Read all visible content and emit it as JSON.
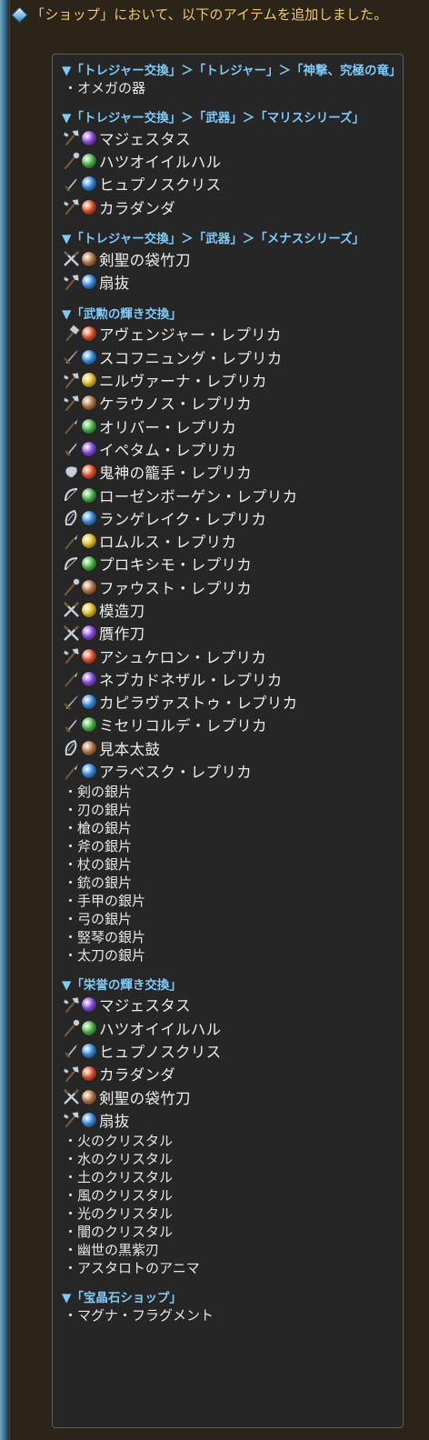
{
  "notice": "「ショップ」において、以下のアイテムを追加しました。",
  "colors": {
    "notice_text": "#f3c86a",
    "category": "#7ec9f5",
    "fire": "#e0552f",
    "water": "#3b8fe0",
    "earth": "#b7784a",
    "wind": "#4db84a",
    "light": "#e6c22a",
    "dark": "#8a4fe0"
  },
  "sections": [
    {
      "title": "▼「トレジャー交換」＞「トレジャー」＞「神撃、究極の竜」",
      "items": [],
      "bullets": [
        "・オメガの器"
      ]
    },
    {
      "title": "▼「トレジャー交換」＞「武器」＞「マリスシリーズ」",
      "items": [
        {
          "name": "マジェスタス",
          "weapon": "axe",
          "element": "dark"
        },
        {
          "name": "ハツオイイルハル",
          "weapon": "staff",
          "element": "wind"
        },
        {
          "name": "ヒュプノスクリス",
          "weapon": "dagger",
          "element": "water"
        },
        {
          "name": "カラダンダ",
          "weapon": "axe",
          "element": "fire"
        }
      ],
      "bullets": []
    },
    {
      "title": "▼「トレジャー交換」＞「武器」＞「メナスシリーズ」",
      "items": [
        {
          "name": "剣聖の袋竹刀",
          "weapon": "katana",
          "element": "earth"
        },
        {
          "name": "扇抜",
          "weapon": "axe",
          "element": "water"
        }
      ],
      "bullets": []
    },
    {
      "title": "▼「武勲の輝き交換」",
      "items": [
        {
          "name": "アヴェンジャー・レプリカ",
          "weapon": "hammer",
          "element": "fire"
        },
        {
          "name": "スコフニュング・レプリカ",
          "weapon": "sword",
          "element": "water"
        },
        {
          "name": "ニルヴァーナ・レプリカ",
          "weapon": "axe",
          "element": "light"
        },
        {
          "name": "ケラウノス・レプリカ",
          "weapon": "axe",
          "element": "earth"
        },
        {
          "name": "オリバー・レプリカ",
          "weapon": "spear",
          "element": "wind"
        },
        {
          "name": "イペタム・レプリカ",
          "weapon": "dagger",
          "element": "dark"
        },
        {
          "name": "鬼神の籠手・レプリカ",
          "weapon": "fist",
          "element": "fire"
        },
        {
          "name": "ローゼンボーゲン・レプリカ",
          "weapon": "bow",
          "element": "wind"
        },
        {
          "name": "ランゲレイク・レプリカ",
          "weapon": "harp",
          "element": "water"
        },
        {
          "name": "ロムルス・レプリカ",
          "weapon": "spear",
          "element": "light"
        },
        {
          "name": "プロキシモ・レプリカ",
          "weapon": "bow",
          "element": "wind"
        },
        {
          "name": "ファウスト・レプリカ",
          "weapon": "staff",
          "element": "earth"
        },
        {
          "name": "模造刀",
          "weapon": "katana",
          "element": "light"
        },
        {
          "name": "贋作刀",
          "weapon": "katana",
          "element": "dark"
        },
        {
          "name": "アシュケロン・レプリカ",
          "weapon": "axe",
          "element": "fire"
        },
        {
          "name": "ネブカドネザル・レプリカ",
          "weapon": "spear",
          "element": "dark"
        },
        {
          "name": "カピラヴァストゥ・レプリカ",
          "weapon": "sword",
          "element": "water"
        },
        {
          "name": "ミセリコルデ・レプリカ",
          "weapon": "dagger",
          "element": "wind"
        },
        {
          "name": "見本太鼓",
          "weapon": "harp",
          "element": "earth"
        },
        {
          "name": "アラベスク・レプリカ",
          "weapon": "spear",
          "element": "water"
        }
      ],
      "bullets": [
        "・剣の銀片",
        "・刃の銀片",
        "・槍の銀片",
        "・斧の銀片",
        "・杖の銀片",
        "・銃の銀片",
        "・手甲の銀片",
        "・弓の銀片",
        "・竪琴の銀片",
        "・太刀の銀片"
      ]
    },
    {
      "title": "▼「栄誉の輝き交換」",
      "items": [
        {
          "name": "マジェスタス",
          "weapon": "axe",
          "element": "dark"
        },
        {
          "name": "ハツオイイルハル",
          "weapon": "staff",
          "element": "wind"
        },
        {
          "name": "ヒュプノスクリス",
          "weapon": "dagger",
          "element": "water"
        },
        {
          "name": "カラダンダ",
          "weapon": "axe",
          "element": "fire"
        },
        {
          "name": "剣聖の袋竹刀",
          "weapon": "katana",
          "element": "earth"
        },
        {
          "name": "扇抜",
          "weapon": "axe",
          "element": "water"
        }
      ],
      "bullets": [
        "・火のクリスタル",
        "・水のクリスタル",
        "・土のクリスタル",
        "・風のクリスタル",
        "・光のクリスタル",
        "・闇のクリスタル",
        "・幽世の黒紫刃",
        "・アスタロトのアニマ"
      ]
    },
    {
      "title": "▼「宝晶石ショップ」",
      "items": [],
      "bullets": [
        "・マグナ・フラグメント"
      ]
    }
  ]
}
